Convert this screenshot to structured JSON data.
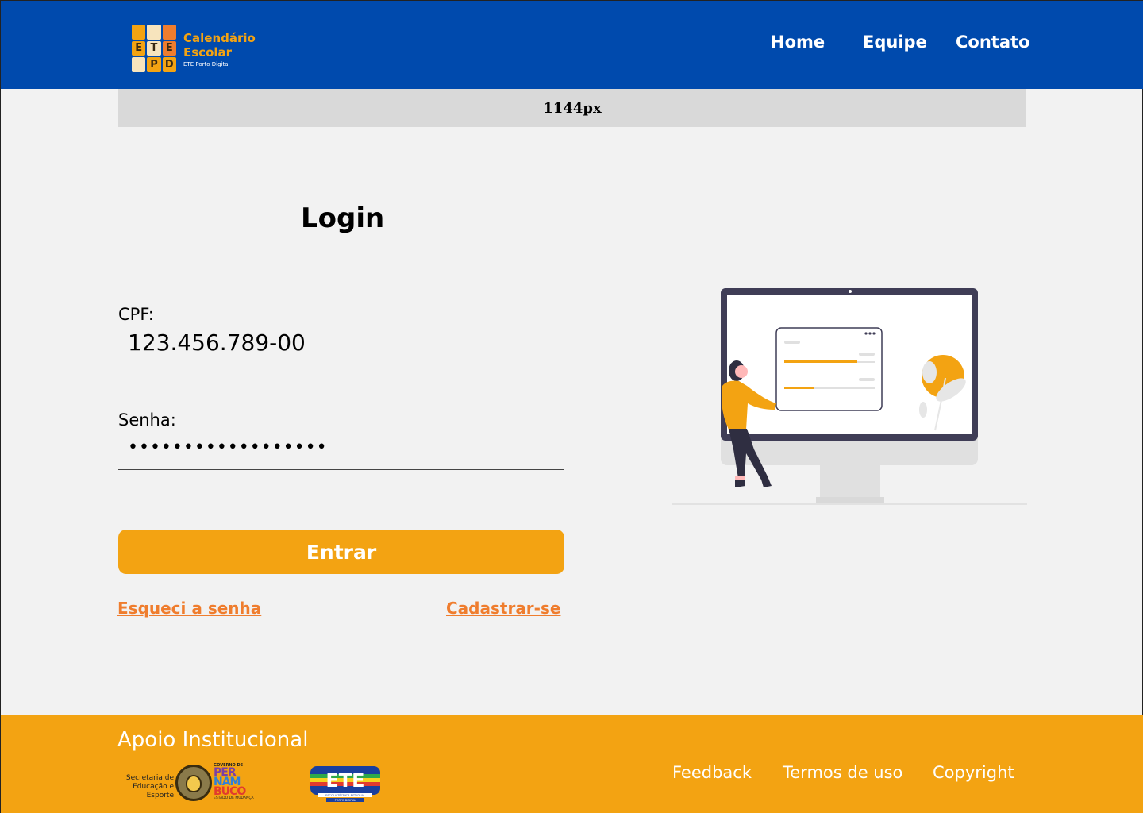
{
  "header": {
    "logo": {
      "grid": [
        "",
        "",
        "",
        "E",
        "T",
        "E",
        "",
        "P",
        "D"
      ],
      "title_line1": "Calendário",
      "title_line2": "Escolar",
      "subtitle": "ETE Porto Digital"
    },
    "nav": {
      "home": "Home",
      "equipe": "Equipe",
      "contato": "Contato"
    }
  },
  "width_bar": {
    "label": "1144px"
  },
  "login": {
    "title": "Login",
    "cpf": {
      "label": "CPF:",
      "value": "123.456.789-00"
    },
    "senha": {
      "label": "Senha:",
      "value": "••••••••••••••••••"
    },
    "submit_label": "Entrar",
    "forgot_label": "Esqueci a senha",
    "signup_label": "Cadastrar-se"
  },
  "footer": {
    "title": "Apoio Institucional",
    "secretaria_text": "Secretaria de Educação e Esporte",
    "pernambuco": {
      "top": "GOVERNO DE",
      "word_lines": [
        "PER",
        "NAM",
        "BUCO"
      ],
      "bottom": "ESTADO DE MUDANÇA"
    },
    "ete_logo": {
      "word": "ETE",
      "line1": "ESCOLA TÉCNICA ESTADUAL",
      "line2": "PORTO DIGITAL"
    },
    "links": {
      "feedback": "Feedback",
      "termos": "Termos de uso",
      "copyright": "Copyright"
    }
  },
  "colors": {
    "header_bg": "#004aad",
    "accent": "#f3a312",
    "link": "#ef7d2e",
    "page_bg": "#f2f2f2",
    "width_bar_bg": "#d9d9d9"
  }
}
